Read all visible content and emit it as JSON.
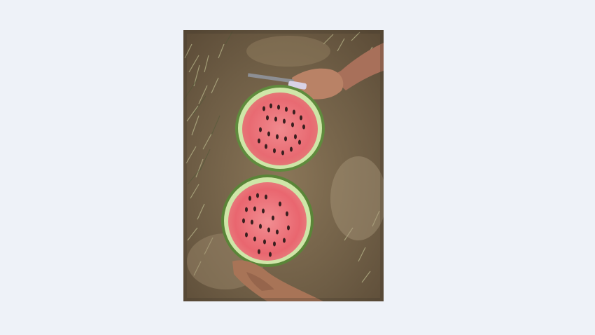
{
  "page": {
    "background_color": "#eef2f8"
  },
  "photo": {
    "subject_icons": [
      "watermark-none"
    ],
    "colors": {
      "ground_dark": "#5e503d",
      "ground_light": "#a89677",
      "grass": "#9aa07a",
      "rind_outer": "#6f9a4a",
      "rind_inner": "#cfe6a8",
      "flesh": "#e86a72",
      "flesh_light": "#f08c90",
      "seed": "#3a1f1f",
      "skin": "#b07a5c",
      "knife_handle": "#d9d2e6"
    }
  }
}
